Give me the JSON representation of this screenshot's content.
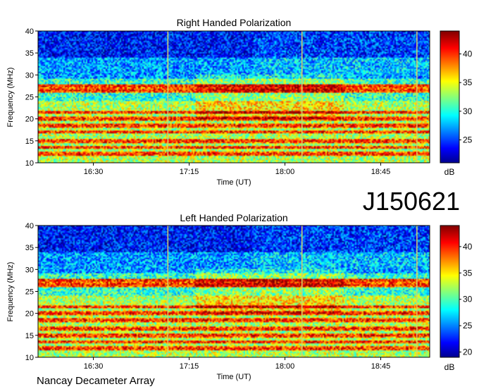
{
  "page": {
    "event_id": "J150621",
    "footer": "Nancay Decameter Array"
  },
  "chart_data": [
    {
      "type": "heatmap",
      "title": "Right Handed Polarization",
      "xlabel": "Time (UT)",
      "ylabel": "Frequency (MHz)",
      "colorbar_label": "dB",
      "x_ticks": [
        "16:30",
        "17:15",
        "18:00",
        "18:45"
      ],
      "y_ticks": [
        10,
        15,
        20,
        25,
        30,
        35,
        40
      ],
      "ylim": [
        10,
        40
      ],
      "colorbar_ticks": [
        25,
        30,
        35,
        40
      ],
      "colorbar_range": [
        21,
        44
      ],
      "colormap": "jet",
      "bright_bands_mhz": [
        12,
        13.5,
        15,
        17,
        18.5,
        20,
        21.5,
        26.5,
        27.5
      ],
      "vertical_markers": [
        "17:05",
        "18:08",
        "19:02"
      ]
    },
    {
      "type": "heatmap",
      "title": "Left Handed Polarization",
      "xlabel": "Time (UT)",
      "ylabel": "Frequency (MHz)",
      "colorbar_label": "dB",
      "x_ticks": [
        "16:30",
        "17:15",
        "18:00",
        "18:45"
      ],
      "y_ticks": [
        10,
        15,
        20,
        25,
        30,
        35,
        40
      ],
      "ylim": [
        10,
        40
      ],
      "colorbar_ticks": [
        20,
        25,
        30,
        35,
        40
      ],
      "colorbar_range": [
        19,
        44
      ],
      "colormap": "jet",
      "bright_bands_mhz": [
        12,
        13.5,
        15,
        16.5,
        18.5,
        20,
        21.5,
        26.5,
        27.5
      ],
      "vertical_markers": [
        "17:05",
        "18:08",
        "19:02"
      ]
    }
  ]
}
